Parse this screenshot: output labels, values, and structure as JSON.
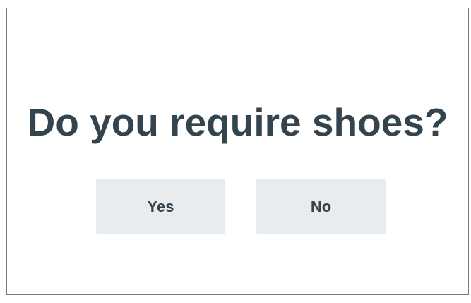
{
  "dialog": {
    "question": "Do you require shoes?",
    "yes_label": "Yes",
    "no_label": "No"
  },
  "colors": {
    "text": "#34444f",
    "button_bg": "#e9ecee",
    "border": "#7a7a7a"
  }
}
